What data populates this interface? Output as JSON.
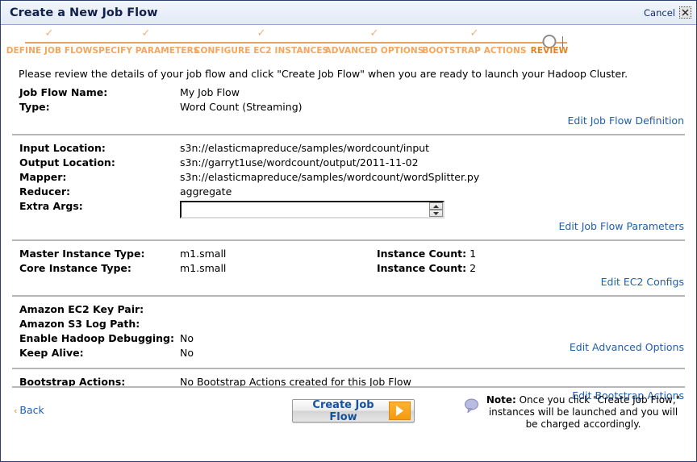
{
  "window": {
    "title": "Create a New Job Flow",
    "cancel_label": "Cancel",
    "close_icon": "close-icon"
  },
  "steps": {
    "items": [
      {
        "label": "DEFINE JOB FLOW",
        "state": "complete",
        "marker": "check"
      },
      {
        "label": "SPECIFY PARAMETERS",
        "state": "complete",
        "marker": "check"
      },
      {
        "label": "CONFIGURE EC2 INSTANCES",
        "state": "complete",
        "marker": "check"
      },
      {
        "label": "ADVANCED OPTIONS",
        "state": "complete",
        "marker": "check"
      },
      {
        "label": "BOOTSTRAP ACTIONS",
        "state": "complete",
        "marker": "check"
      },
      {
        "label": "REVIEW",
        "state": "current",
        "marker": "circle"
      }
    ],
    "accent_color": "#e8821c",
    "complete_color": "#f5a55c"
  },
  "intro": "Please review the details of your job flow and click \"Create Job Flow\" when you are ready to launch your Hadoop Cluster.",
  "sections": {
    "definition": {
      "rows": [
        {
          "label": "Job Flow Name:",
          "value": "My Job Flow"
        },
        {
          "label": "Type:",
          "value": "Word Count (Streaming)"
        }
      ],
      "edit_label": "Edit Job Flow Definition"
    },
    "parameters": {
      "rows": [
        {
          "label": "Input Location:",
          "value": "s3n://elasticmapreduce/samples/wordcount/input"
        },
        {
          "label": "Output Location:",
          "value": "s3n://garryt1use/wordcount/output/2011-11-02"
        },
        {
          "label": "Mapper:",
          "value": "s3n://elasticmapreduce/samples/wordcount/wordSplitter.py"
        },
        {
          "label": "Reducer:",
          "value": "aggregate"
        }
      ],
      "extra_args": {
        "label": "Extra Args:",
        "value": "",
        "placeholder": ""
      },
      "edit_label": "Edit Job Flow Parameters"
    },
    "ec2": {
      "rows": [
        {
          "label": "Master Instance Type:",
          "value": "m1.small",
          "count_label": "Instance Count:",
          "count_value": "1"
        },
        {
          "label": "Core Instance Type:",
          "value": "m1.small",
          "count_label": "Instance Count:",
          "count_value": "2"
        }
      ],
      "edit_label": "Edit EC2 Configs"
    },
    "advanced": {
      "rows": [
        {
          "label": "Amazon EC2 Key Pair:",
          "value": ""
        },
        {
          "label": "Amazon S3 Log Path:",
          "value": ""
        },
        {
          "label": "Enable Hadoop Debugging:",
          "value": "No"
        },
        {
          "label": "Keep Alive:",
          "value": "No"
        }
      ],
      "edit_label": "Edit Advanced Options"
    },
    "bootstrap": {
      "rows": [
        {
          "label": "Bootstrap Actions:",
          "value": "No Bootstrap Actions created for this Job Flow"
        }
      ],
      "edit_label": "Edit Bootstrap Actions"
    }
  },
  "footer": {
    "back_label": "Back",
    "create_label": "Create Job Flow",
    "note_strong": "Note:",
    "note_text": " Once you click \"Create Job Flow,\" instances will be launched and you will be charged accordingly.",
    "note_icon": "speech-bubble-icon",
    "arrow_icon": "arrow-right-icon"
  }
}
